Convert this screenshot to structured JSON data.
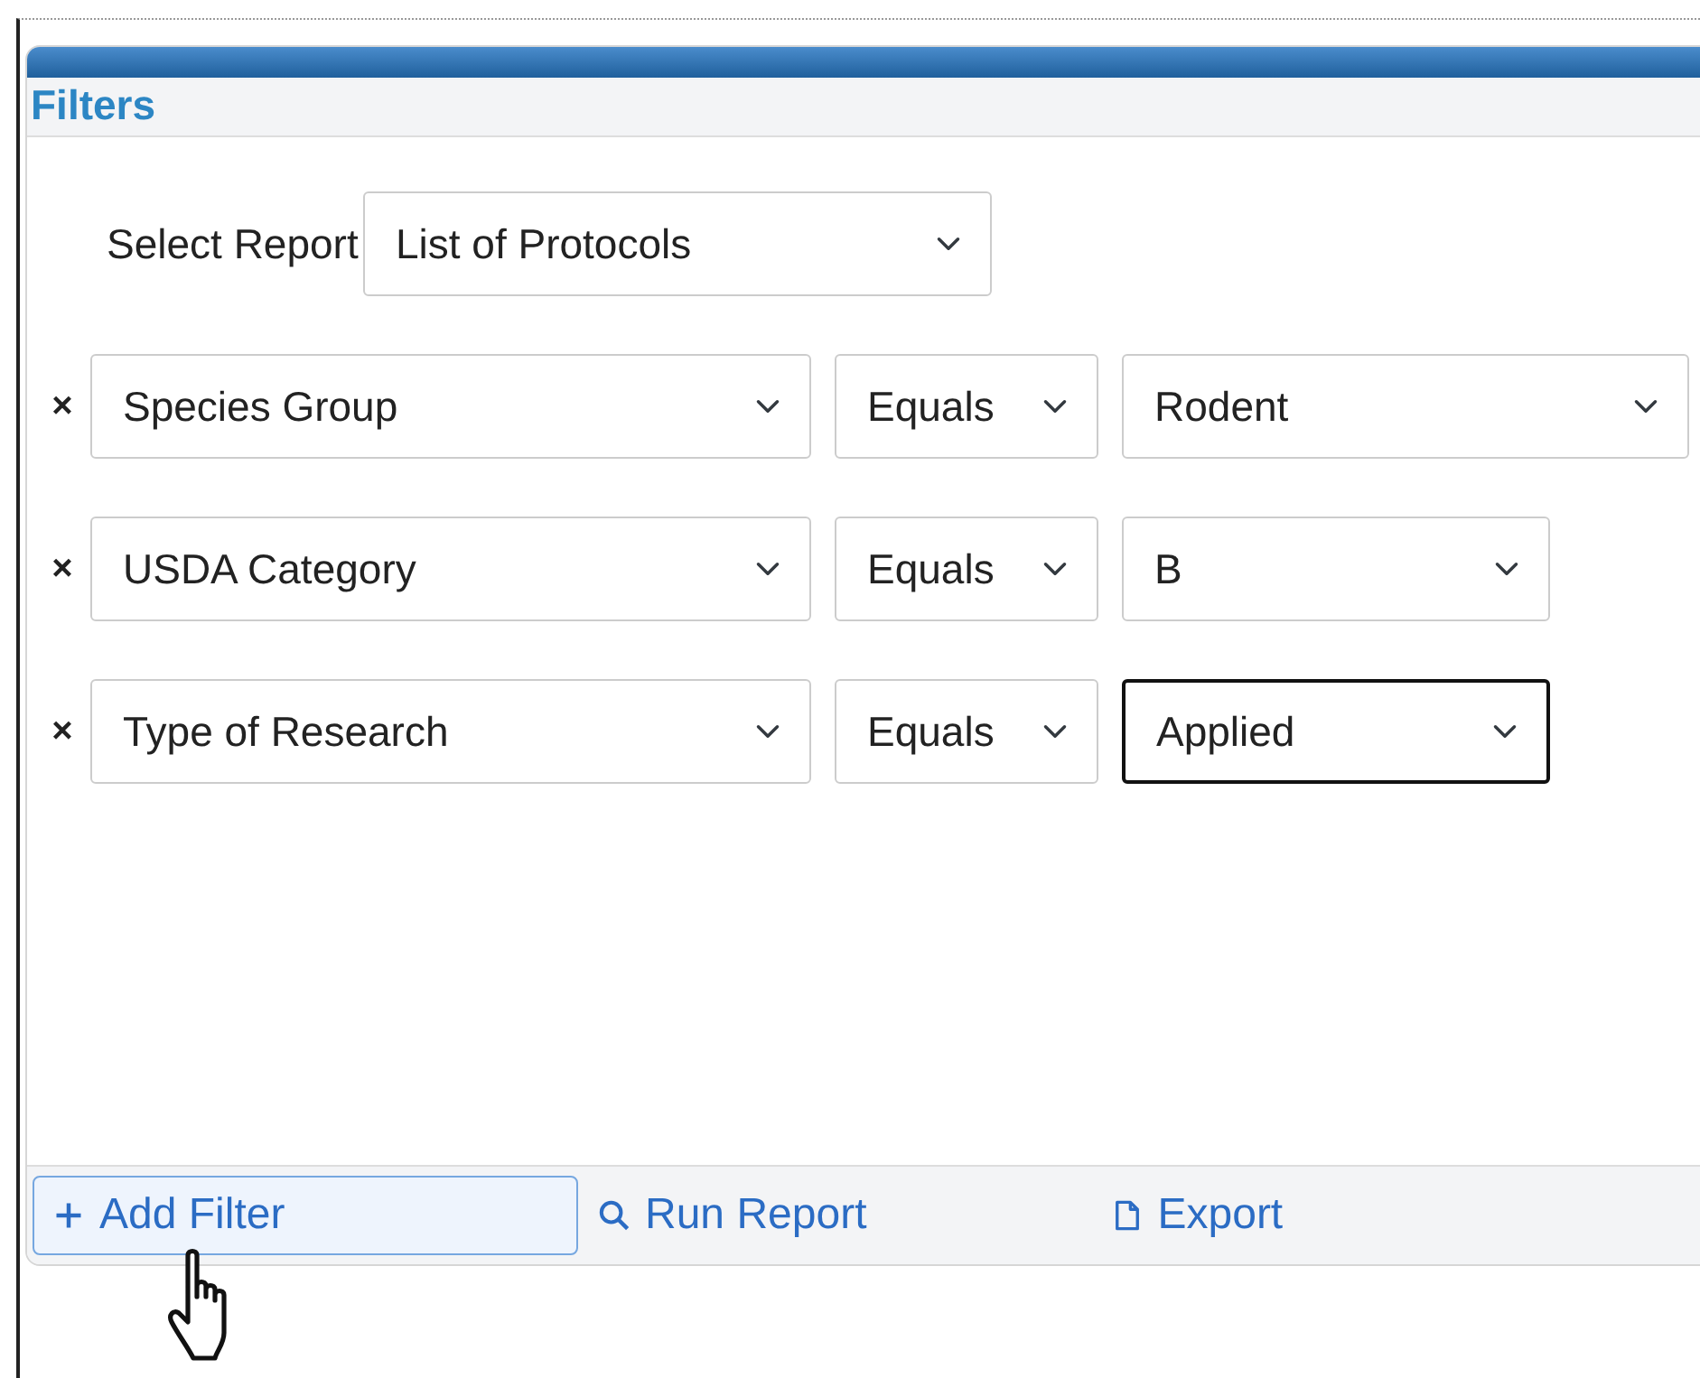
{
  "panel": {
    "title": "Filters"
  },
  "report": {
    "label": "Select Report",
    "value": "List of Protocols"
  },
  "filters": [
    {
      "remove": "×",
      "field": "Species Group",
      "operator": "Equals",
      "value": "Rodent",
      "wide": true,
      "focused": false
    },
    {
      "remove": "×",
      "field": "USDA Category",
      "operator": "Equals",
      "value": "B",
      "wide": false,
      "focused": false
    },
    {
      "remove": "×",
      "field": "Type of Research",
      "operator": "Equals",
      "value": "Applied",
      "wide": false,
      "focused": true
    }
  ],
  "actions": [
    {
      "kind": "add",
      "label": "Add Filter",
      "hovered": true
    },
    {
      "kind": "run",
      "label": "Run Report",
      "hovered": false
    },
    {
      "kind": "export",
      "label": "Export",
      "hovered": false
    }
  ]
}
